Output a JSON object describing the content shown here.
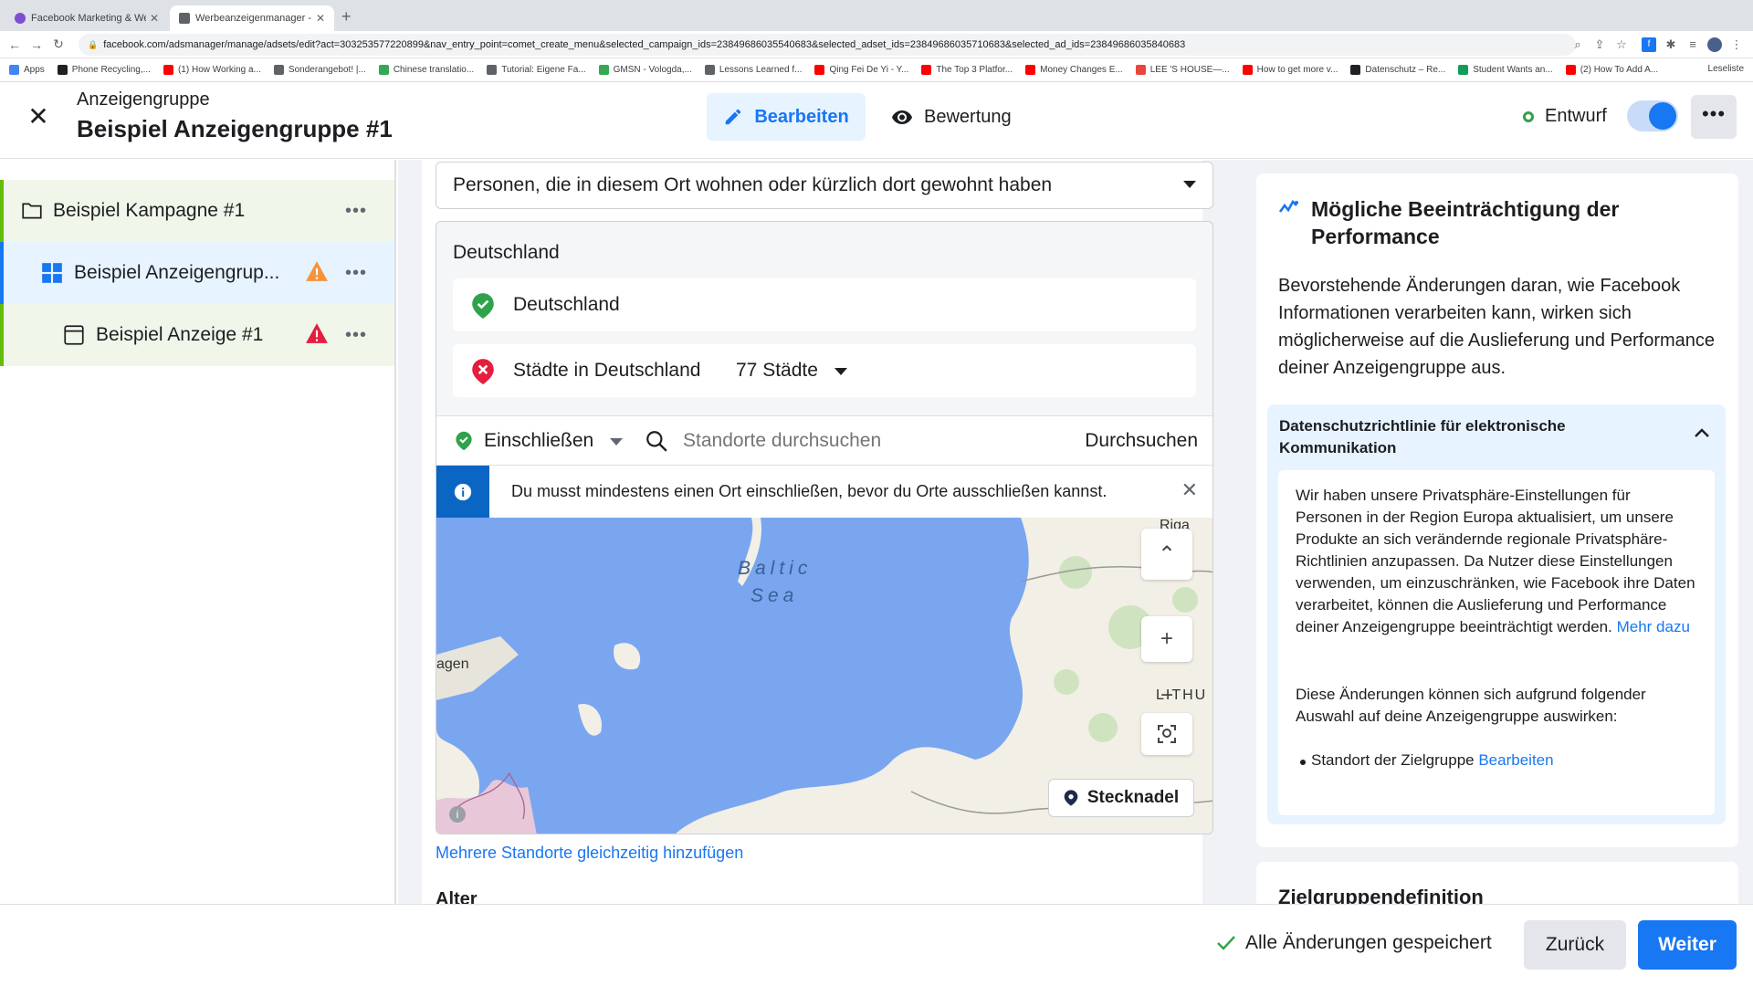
{
  "browser": {
    "tabs": [
      {
        "title": "Facebook Marketing & Werbea",
        "active": false,
        "favicon_color": "#7b4fd0"
      },
      {
        "title": "Werbeanzeigenmanager - Wer",
        "active": true,
        "favicon_color": "#5f6368"
      }
    ],
    "url": "facebook.com/adsmanager/manage/adsets/edit?act=303253577220899&nav_entry_point=comet_create_menu&selected_campaign_ids=23849686035540683&selected_adset_ids=23849686035710683&selected_ad_ids=23849686035840683",
    "bookmarks": [
      {
        "label": "Apps",
        "color": "#4285f4"
      },
      {
        "label": "Phone Recycling,...",
        "color": "#202124"
      },
      {
        "label": "(1) How Working a...",
        "color": "#ff0000"
      },
      {
        "label": "Sonderangebot! |...",
        "color": "#5f6368"
      },
      {
        "label": "Chinese translatio...",
        "color": "#34a853"
      },
      {
        "label": "Tutorial: Eigene Fa...",
        "color": "#5f6368"
      },
      {
        "label": "GMSN - Vologda,...",
        "color": "#34a853"
      },
      {
        "label": "Lessons Learned f...",
        "color": "#5f6368"
      },
      {
        "label": "Qing Fei De Yi - Y...",
        "color": "#ff0000"
      },
      {
        "label": "The Top 3 Platfor...",
        "color": "#ff0000"
      },
      {
        "label": "Money Changes E...",
        "color": "#ff0000"
      },
      {
        "label": "LEE 'S HOUSE—...",
        "color": "#e8453c"
      },
      {
        "label": "How to get more v...",
        "color": "#ff0000"
      },
      {
        "label": "Datenschutz – Re...",
        "color": "#202124"
      },
      {
        "label": "Student Wants an...",
        "color": "#0f9d58"
      },
      {
        "label": "(2) How To Add A...",
        "color": "#ff0000"
      }
    ],
    "reading_list": "Leseliste"
  },
  "header": {
    "subtitle": "Anzeigengruppe",
    "title": "Beispiel Anzeigengruppe #1",
    "edit_label": "Bearbeiten",
    "review_label": "Bewertung",
    "status_label": "Entwurf",
    "accent": "#1877f2"
  },
  "sidebar": {
    "campaign": {
      "label": "Beispiel Kampagne #1",
      "icon": "folder-icon"
    },
    "adset": {
      "label": "Beispiel Anzeigengrup...",
      "icon": "grid-icon",
      "warning": "warning-orange-icon"
    },
    "ad": {
      "label": "Beispiel Anzeige #1",
      "icon": "ad-page-icon",
      "warning": "warning-red-icon"
    }
  },
  "location": {
    "audience_select": "Personen, die in diesem Ort wohnen oder kürzlich dort gewohnt haben",
    "country_title": "Deutschland",
    "included": "Deutschland",
    "excluded_label": "Städte in Deutschland",
    "excluded_count": "77 Städte",
    "include_label": "Einschließen",
    "search_placeholder": "Standorte durchsuchen",
    "search_button": "Durchsuchen",
    "info_text": "Du musst mindestens einen Ort einschließen, bevor du Orte ausschließen kannst.",
    "map": {
      "sea_label_1": "Baltic",
      "sea_label_2": "Sea",
      "city_riga": "Riga",
      "city_copenhagen": "agen",
      "country_lith": "LITHU",
      "pin_button": "Stecknadel"
    },
    "multi_link": "Mehrere Standorte gleichzeitig hinzufügen",
    "age_label": "Alter"
  },
  "right_panel": {
    "title": "Mögliche Beeinträchtigung der Performance",
    "body": "Bevorstehende Änderungen daran, wie Facebook Informationen verarbeiten kann, wirken sich möglicherweise auf die Auslieferung und Performance deiner Anzeigengruppe aus.",
    "accordion_title": "Datenschutzrichtlinie für elektronische Kommunikation",
    "accordion_text": "Wir haben unsere Privatsphäre-Einstellungen für Personen in der Region Europa aktualisiert, um unsere Produkte an sich verändernde regionale Privatsphäre-Richtlinien anzupassen. Da Nutzer diese Einstellungen verwenden, um einzuschränken, wie Facebook ihre Daten verarbeitet, können die Auslieferung und Performance deiner Anzeigengruppe beeinträchtigt werden.",
    "more_link": "Mehr dazu",
    "accordion_text2": "Diese Änderungen können sich aufgrund folgender Auswahl auf deine Anzeigengruppe auswirken:",
    "bullet_text": "Standort der Zielgruppe",
    "bullet_link": "Bearbeiten",
    "next_card_title": "Zielgruppendefinition"
  },
  "footer": {
    "saved_text": "Alle Änderungen gespeichert",
    "back_label": "Zurück",
    "next_label": "Weiter"
  }
}
